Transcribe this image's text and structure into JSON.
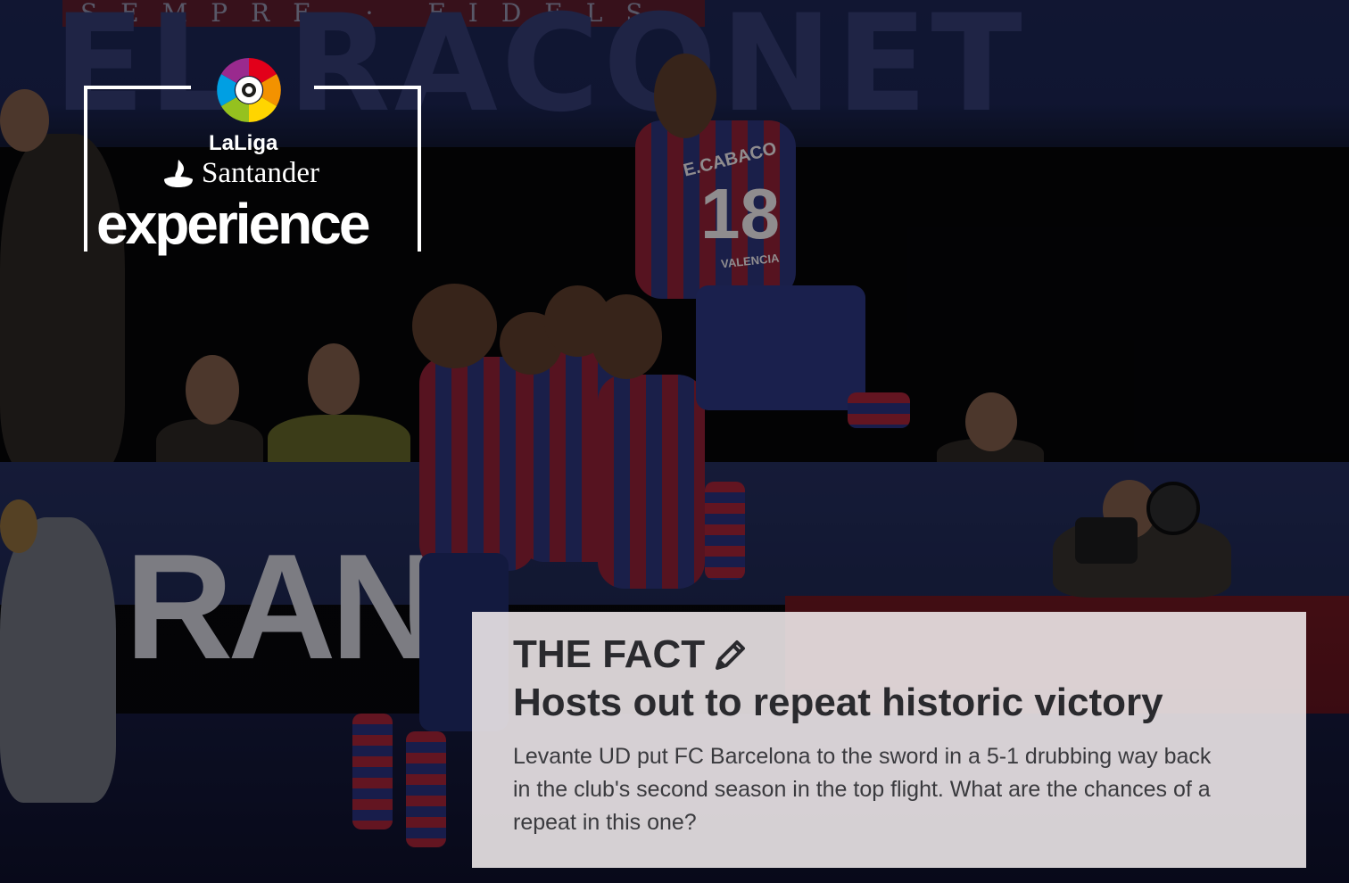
{
  "background": {
    "strip_text": "SEMPRE · FIDELS",
    "banner_text": "EL RACONET",
    "ad_board_text": "RANS",
    "player": {
      "name": "E.CABACO",
      "number": "18",
      "sponsor": "VALENCIA"
    }
  },
  "logo": {
    "brand_line_1": "LaLiga",
    "brand_line_2": "Santander",
    "brand_line_3": "experience",
    "colors": [
      "#e2001a",
      "#f39200",
      "#ffd500",
      "#95c11f",
      "#009fe3",
      "#1d3c8f",
      "#9a2a8e"
    ]
  },
  "card": {
    "kicker": "THE FACT",
    "kicker_icon": "pencil-icon",
    "title": "Hosts out to repeat historic victory",
    "body": "Levante UD put FC Barcelona to the sword in a 5-1 drubbing way back in the club's second season in the top flight. What are the chances of a repeat in this one?"
  }
}
